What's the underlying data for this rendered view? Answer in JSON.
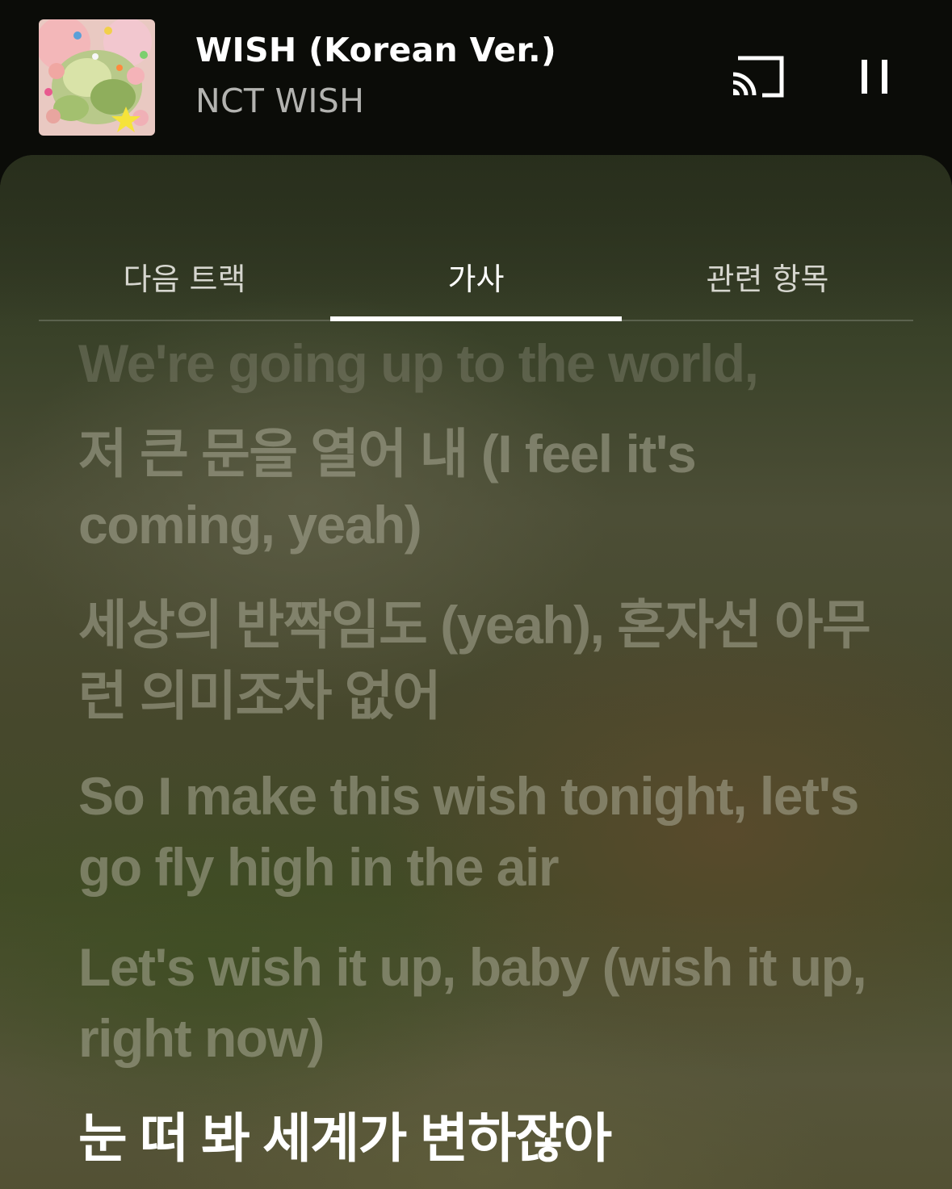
{
  "now_playing": {
    "title": "WISH (Korean Ver.)",
    "artist": "NCT WISH",
    "album_art": "album-cover"
  },
  "controls": {
    "cast_icon": "cast-icon",
    "pause_icon": "pause-icon"
  },
  "tabs": [
    {
      "label": "다음 트랙",
      "active": false
    },
    {
      "label": "가사",
      "active": true
    },
    {
      "label": "관련 항목",
      "active": false
    }
  ],
  "lyrics": {
    "lines": [
      "We're going up to the world,",
      "저 큰 문을 열어 내 (I feel it's coming, yeah)",
      "세상의 반짝임도 (yeah), 혼자선 아무런 의미조차 없어",
      "So I make this wish tonight, let's go fly high in the air",
      "Let's wish it up, baby (wish it up, right now)",
      "눈 떠 봐 세계가 변하잖아"
    ],
    "current_index": 5
  },
  "colors": {
    "background": "#0b0c08",
    "active_text": "#ffffff",
    "inactive_lyric": "#aaaa96"
  }
}
